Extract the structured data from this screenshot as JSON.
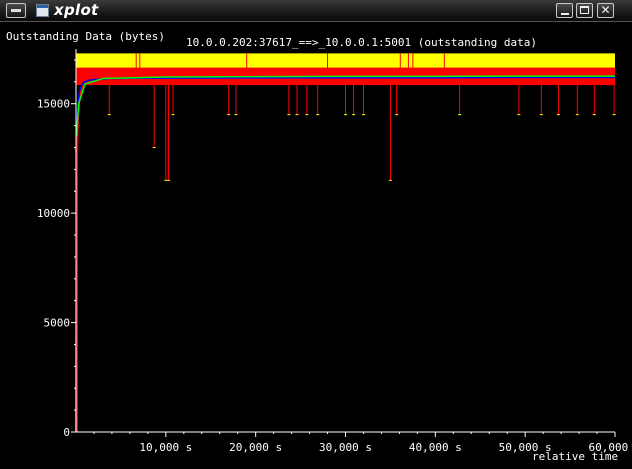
{
  "window": {
    "title": "xplot",
    "close_glyph": "✕"
  },
  "icons": {
    "menu": "window-menu-icon",
    "app": "xplot-app-icon",
    "minimize": "minimize-icon",
    "maximize": "maximize-icon",
    "close": "close-icon"
  },
  "colors": {
    "background": "#000000",
    "axis": "#ffffff",
    "text": "#ffffff",
    "window_band": "#ffff00",
    "outstanding": "#ff0000",
    "average": "#0000ff",
    "sample": "#00ff00"
  },
  "chart_data": {
    "type": "line",
    "title": "10.0.0.202:37617_==>_10.0.0.1:5001 (outstanding data)",
    "ylabel": "Outstanding Data (bytes)",
    "xlabel": "relative time",
    "xlim": [
      0,
      60000
    ],
    "ylim": [
      0,
      17500
    ],
    "x_ticks": [
      10000,
      20000,
      30000,
      40000,
      50000,
      60000
    ],
    "x_tick_labels": [
      "10,000 s",
      "20,000 s",
      "30,000 s",
      "40,000 s",
      "50,000 s",
      "60,000 s"
    ],
    "y_ticks": [
      0,
      5000,
      10000,
      15000
    ],
    "y_tick_labels": [
      "0",
      "5000",
      "10000",
      "15000"
    ],
    "grid": false,
    "window_band": {
      "name": "window",
      "color": "#ffff00",
      "from": 16500,
      "to": 17300
    },
    "series": [
      {
        "color": "#ff0000",
        "x": [
          0,
          50,
          100,
          200,
          400,
          700,
          1000,
          1500,
          2500,
          4000,
          6000,
          10000,
          20000,
          30000,
          40000,
          50000,
          60000
        ],
        "y": [
          0,
          6000,
          12500,
          14200,
          15300,
          15800,
          16000,
          16150,
          16250,
          16300,
          16320,
          16330,
          16330,
          16340,
          16340,
          16340,
          16340
        ]
      },
      {
        "color": "#0000ff",
        "x": [
          0,
          50,
          100,
          200,
          400,
          700,
          1000,
          1500,
          2500,
          4000,
          6000,
          10000,
          20000,
          30000,
          40000,
          50000,
          60000
        ],
        "y": [
          12000,
          13500,
          14200,
          15000,
          15600,
          15900,
          16000,
          16080,
          16120,
          16150,
          16160,
          16170,
          16180,
          16190,
          16190,
          16200,
          16200
        ]
      },
      {
        "color": "#00ff00",
        "x": [
          0,
          100,
          300,
          1000,
          3000,
          10000,
          20000,
          30000,
          40000,
          50000,
          60000
        ],
        "y": [
          12800,
          13800,
          15000,
          15900,
          16150,
          16220,
          16240,
          16250,
          16250,
          16260,
          16260
        ]
      }
    ],
    "dips": {
      "color": "#ff0000",
      "x": [
        3700,
        8700,
        10000,
        10300,
        10800,
        17000,
        17800,
        23700,
        24600,
        25700,
        26900,
        30000,
        30900,
        32000,
        35000,
        35700,
        42700,
        49300,
        51800,
        53700,
        55800,
        57700,
        59900
      ],
      "y": [
        14500,
        13000,
        11500,
        11500,
        14500,
        14500,
        14500,
        14500,
        14500,
        14500,
        14500,
        14500,
        14500,
        14500,
        11500,
        14500,
        14500,
        14500,
        14500,
        14500,
        14500,
        14500,
        14500
      ]
    },
    "spikes": {
      "color": "#ff0000",
      "x": [
        6700,
        7100,
        19000,
        28000,
        36100,
        37000,
        37500,
        41000
      ],
      "y": [
        17300,
        17300,
        17300,
        17300,
        17300,
        17300,
        17300,
        17300
      ]
    }
  }
}
